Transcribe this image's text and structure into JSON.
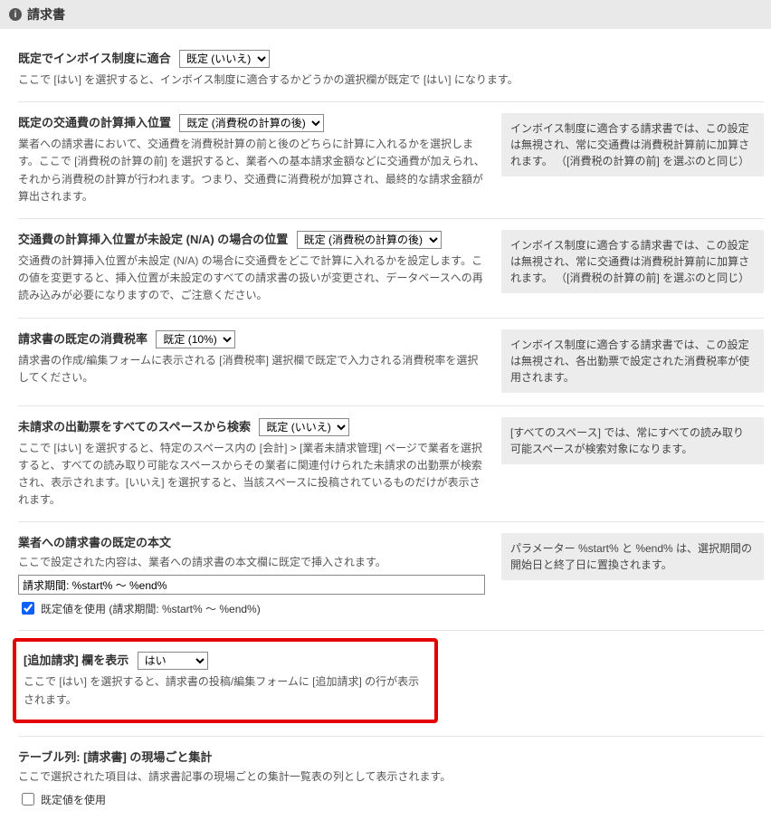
{
  "header": {
    "title": "請求書"
  },
  "s1": {
    "label": "既定でインボイス制度に適合",
    "options": [
      "既定 (いいえ)"
    ],
    "desc": "ここで [はい] を選択すると、インボイス制度に適合するかどうかの選択欄が既定で [はい] になります。"
  },
  "s2": {
    "label": "既定の交通費の計算挿入位置",
    "options": [
      "既定 (消費税の計算の後)"
    ],
    "desc": "業者への請求書において、交通費を消費税計算の前と後のどちらに計算に入れるかを選択します。ここで [消費税の計算の前] を選択すると、業者への基本請求金額などに交通費が加えられ、それから消費税の計算が行われます。つまり、交通費に消費税が加算され、最終的な請求金額が算出されます。",
    "note": "インボイス制度に適合する請求書では、この設定は無視され、常に交通費は消費税計算前に加算されます。 （[消費税の計算の前] を選ぶのと同じ）"
  },
  "s3": {
    "label": "交通費の計算挿入位置が未設定 (N/A) の場合の位置",
    "options": [
      "既定 (消費税の計算の後)"
    ],
    "desc": "交通費の計算挿入位置が未設定 (N/A) の場合に交通費をどこで計算に入れるかを設定します。この値を変更すると、挿入位置が未設定のすべての請求書の扱いが変更され、データベースへの再読み込みが必要になりますので、ご注意ください。",
    "note": "インボイス制度に適合する請求書では、この設定は無視され、常に交通費は消費税計算前に加算されます。 （[消費税の計算の前] を選ぶのと同じ）"
  },
  "s4": {
    "label": "請求書の既定の消費税率",
    "options": [
      "既定 (10%)"
    ],
    "desc": "請求書の作成/編集フォームに表示される [消費税率] 選択欄で既定で入力される消費税率を選択してください。",
    "note": "インボイス制度に適合する請求書では、この設定は無視され、各出勤票で設定された消費税率が使用されます。"
  },
  "s5": {
    "label": "未請求の出勤票をすべてのスペースから検索",
    "options": [
      "既定 (いいえ)"
    ],
    "desc": "ここで [はい] を選択すると、特定のスペース内の [会計] > [業者未請求管理] ページで業者を選択すると、すべての読み取り可能なスペースからその業者に関連付けられた未請求の出勤票が検索され、表示されます。[いいえ] を選択すると、当該スペースに投稿されているものだけが表示されます。",
    "note": "[すべてのスペース] では、常にすべての読み取り可能スペースが検索対象になります。"
  },
  "s6": {
    "label": "業者への請求書の既定の本文",
    "desc": "ここで設定された内容は、業者への請求書の本文欄に既定で挿入されます。",
    "input_value": "請求期間: %start% ～ %end%",
    "checkbox_label": "既定値を使用 (請求期間: %start% ～ %end%)",
    "note": "パラメーター %start% と %end% は、選択期間の開始日と終了日に置換されます。"
  },
  "s7": {
    "label": "[追加請求] 欄を表示",
    "options": [
      "はい"
    ],
    "desc": "ここで [はい] を選択すると、請求書の投稿/編集フォームに [追加請求] の行が表示されます。"
  },
  "s8": {
    "label": "テーブル列: [請求書] の現場ごと集計",
    "desc": "ここで選択された項目は、請求書記事の現場ごとの集計一覧表の列として表示されます。",
    "checkbox_label": "既定値を使用"
  }
}
